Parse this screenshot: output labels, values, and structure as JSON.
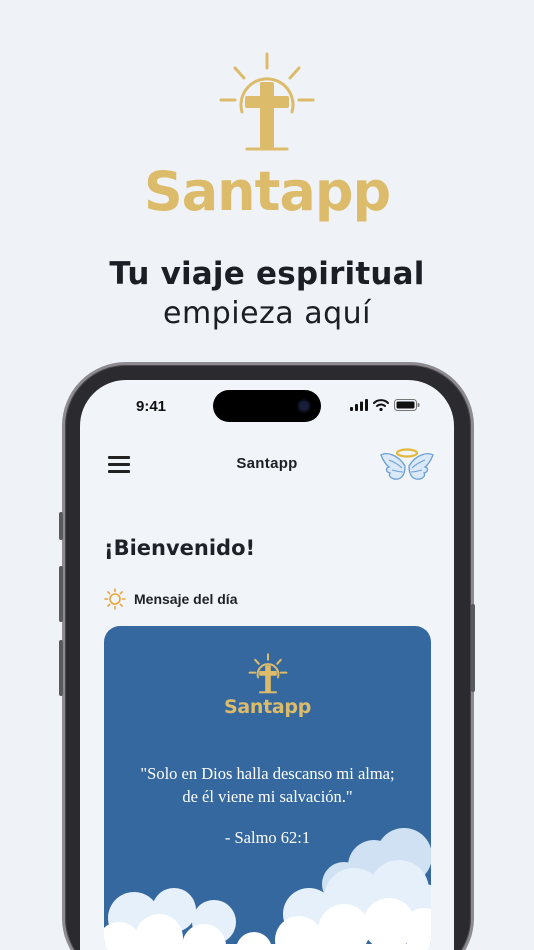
{
  "hero": {
    "brand": "Santapp",
    "tagline_line1": "Tu viaje espiritual",
    "tagline_line2": "empieza aquí"
  },
  "status_bar": {
    "time": "9:41"
  },
  "app_bar": {
    "title": "Santapp"
  },
  "home": {
    "greeting": "¡Bienvenido!",
    "section_label": "Mensaje del día"
  },
  "daily_card": {
    "brand": "Santapp",
    "quote_line1": "\"Solo en Dios halla descanso mi alma;",
    "quote_line2": "de él viene mi salvación.\"",
    "reference": "- Salmo 62:1"
  },
  "colors": {
    "background": "#eff2f7",
    "gold": "#dcbc6a",
    "card_blue": "#35689f",
    "text_dark": "#1c1e25"
  },
  "icons": [
    "cross-sun-logo-icon",
    "menu-icon",
    "angel-wings-icon",
    "sun-icon",
    "signal-icon",
    "wifi-icon",
    "battery-icon"
  ]
}
